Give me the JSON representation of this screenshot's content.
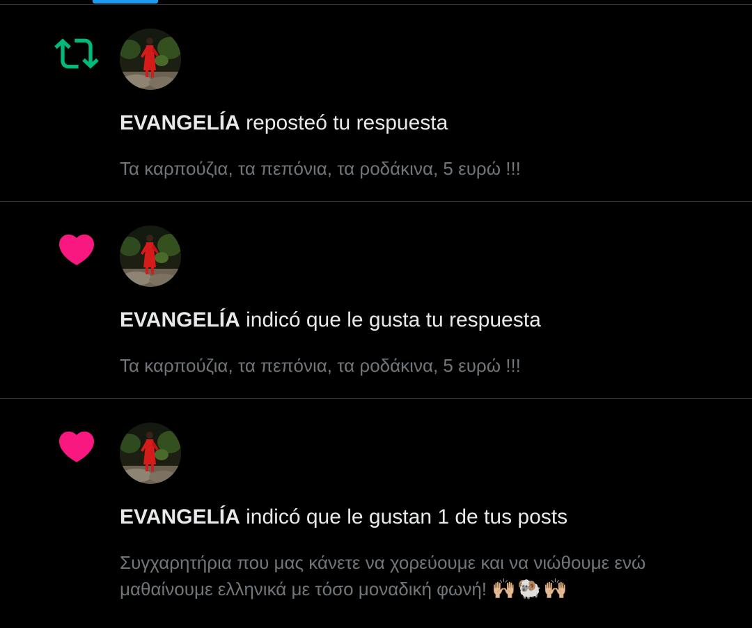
{
  "colors": {
    "background": "#000000",
    "divider": "#2f3336",
    "repost": "#00ba7c",
    "like": "#f91880",
    "primary_text": "#e7e9ea",
    "secondary_text": "#71767b",
    "tab_accent": "#1d9bf0"
  },
  "notifications": [
    {
      "type": "repost",
      "icon": "repost-icon",
      "user": "EVANGELÍA",
      "action": " reposteó tu respuesta",
      "snippet": "Τα καρπούζια, τα πεπόνια, τα ροδάκινα, 5 ευρώ !!!"
    },
    {
      "type": "like",
      "icon": "heart-icon",
      "user": "EVANGELÍA",
      "action": " indicó que le gusta tu respuesta",
      "snippet": "Τα καρπούζια, τα πεπόνια, τα ροδάκινα, 5 ευρώ !!!"
    },
    {
      "type": "like",
      "icon": "heart-icon",
      "user": "EVANGELÍA",
      "action": " indicó que le gustan 1 de tus posts",
      "snippet": "Συγχαρητήρια που μας κάνετε να χορεύουμε και να νιώθουμε ενώ μαθαίνουμε ελληνικά με τόσο μοναδική φωνή!",
      "emoji": "🙌🏼🐏🙌🏼"
    }
  ]
}
